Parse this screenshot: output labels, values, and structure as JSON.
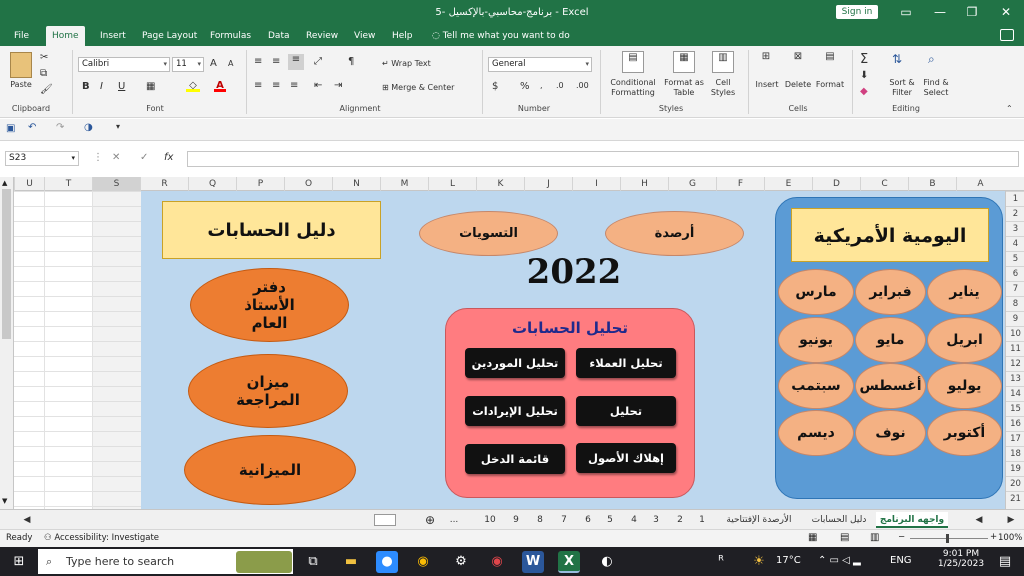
{
  "window": {
    "title": "برنامج-محاسبي-بالإكسيل -5  -  Excel",
    "signin": "Sign in"
  },
  "ribbon_tabs": [
    "File",
    "Home",
    "Insert",
    "Page Layout",
    "Formulas",
    "Data",
    "Review",
    "View",
    "Help"
  ],
  "active_tab": "Home",
  "tell_me": "Tell me what you want to do",
  "ribbon": {
    "clipboard": {
      "paste": "Paste",
      "label": "Clipboard"
    },
    "font": {
      "name": "Calibri",
      "size": "11",
      "bold": "B",
      "italic": "I",
      "underline": "U",
      "grow": "A",
      "shrink": "A",
      "label": "Font"
    },
    "alignment": {
      "wrap": "Wrap Text",
      "merge": "Merge & Center",
      "label": "Alignment"
    },
    "number": {
      "format": "General",
      "currency": "$",
      "percent": "%",
      "label": "Number"
    },
    "styles": {
      "conditional": "Conditional Formatting",
      "format_table": "Format as Table",
      "cell_styles": "Cell Styles",
      "label": "Styles"
    },
    "cells": {
      "insert": "Insert",
      "delete": "Delete",
      "format": "Format",
      "label": "Cells"
    },
    "editing": {
      "sort": "Sort & Filter",
      "find": "Find & Select",
      "label": "Editing"
    }
  },
  "formula_bar": {
    "name_box": "S23",
    "fx": "fx",
    "value": ""
  },
  "columns": [
    "U",
    "T",
    "S",
    "R",
    "Q",
    "P",
    "O",
    "N",
    "M",
    "L",
    "K",
    "J",
    "I",
    "H",
    "G",
    "F",
    "E",
    "D",
    "C",
    "B",
    "A"
  ],
  "rows": [
    "1",
    "2",
    "3",
    "4",
    "5",
    "6",
    "7",
    "8",
    "9",
    "10",
    "11",
    "12",
    "13",
    "14",
    "15",
    "16",
    "17",
    "18",
    "19",
    "20",
    "21"
  ],
  "dashboard": {
    "journal_title": "اليومية الأمريكية",
    "months": [
      "يناير",
      "فبراير",
      "مارس",
      "ابريل",
      "مايو",
      "يونيو",
      "يوليو",
      "أغسطس",
      "سبتمب",
      "أكتوبر",
      "نوف",
      "ديسم"
    ],
    "balances": "أرصدة",
    "settlements": "التسويات",
    "year": "2022",
    "analysis_title": "تحليل الحسابات",
    "analysis_buttons": [
      "تحليل العملاء",
      "تحليل الموردين",
      "تحليل",
      "تحليل الإيرادات",
      "إهلاك الأصول",
      "قائمة الدخل"
    ],
    "accounts_guide": "دليل الحسابات",
    "ledger": "دفتر الأستاذ العام",
    "trial_balance": "ميزان المراجعة",
    "budget": "الميزانية"
  },
  "sheet_tabs": [
    "واجهه البرنامج",
    "دليل الحسابات",
    "الأرصدة الإفتتاحية",
    "1",
    "2",
    "3",
    "4",
    "5",
    "6",
    "7",
    "8",
    "9",
    "10",
    "..."
  ],
  "active_sheet": "واجهه البرنامج",
  "status": {
    "ready": "Ready",
    "accessibility": "Accessibility: Investigate",
    "zoom": "100%"
  },
  "taskbar": {
    "search": "Type here to search",
    "weather": "17°C",
    "lang": "ENG",
    "time": "9:01 PM",
    "date": "1/25/2023"
  }
}
